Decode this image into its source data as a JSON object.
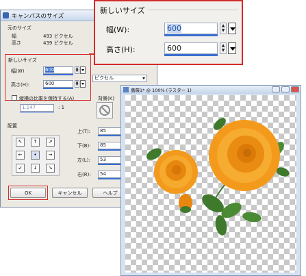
{
  "dialog": {
    "title": "キャンバスのサイズ",
    "help_glyph": "?",
    "original_size": {
      "heading": "元のサイズ",
      "width_label": "幅",
      "width_value": "493 ピクセル",
      "height_label": "高さ",
      "height_value": "439 ピクセル"
    },
    "new_size": {
      "heading": "新しいサイズ",
      "width_label": "幅(W)",
      "width_value": "600",
      "height_label": "高さ(H):",
      "height_value": "600",
      "unit": "ピクセル"
    },
    "aspect": {
      "label": "縦横の比率を保持する(A)",
      "checked": false,
      "ratio_value": "1.147",
      "ratio_suffix": ": 1"
    },
    "background": {
      "label": "背景(K)"
    },
    "placement": {
      "heading": "配置",
      "anchors": [
        "↖",
        "↑",
        "↗",
        "←",
        "•",
        "→",
        "↙",
        "↓",
        "↘"
      ],
      "selected_index": 4,
      "top_label": "上(T):",
      "top_value": "85",
      "bottom_label": "下(B):",
      "bottom_value": "85",
      "left_label": "左(L):",
      "left_value": "53",
      "right_label": "右(R):",
      "right_value": "54"
    },
    "buttons": {
      "ok": "OK",
      "cancel": "キャンセル",
      "help": "ヘルプ"
    }
  },
  "zoom": {
    "heading": "新しいサイズ",
    "width_label": "幅(W):",
    "width_value": "600",
    "height_label": "高さ(H):",
    "height_value": "600"
  },
  "image_window": {
    "title": "薔薇1* @ 100% (ラスター 1)"
  },
  "colors": {
    "highlight_red": "#d42a2a",
    "accent_blue": "#3a6fcf",
    "petal_orange": "#f39a1c",
    "leaf_green": "#3f7a2c"
  }
}
